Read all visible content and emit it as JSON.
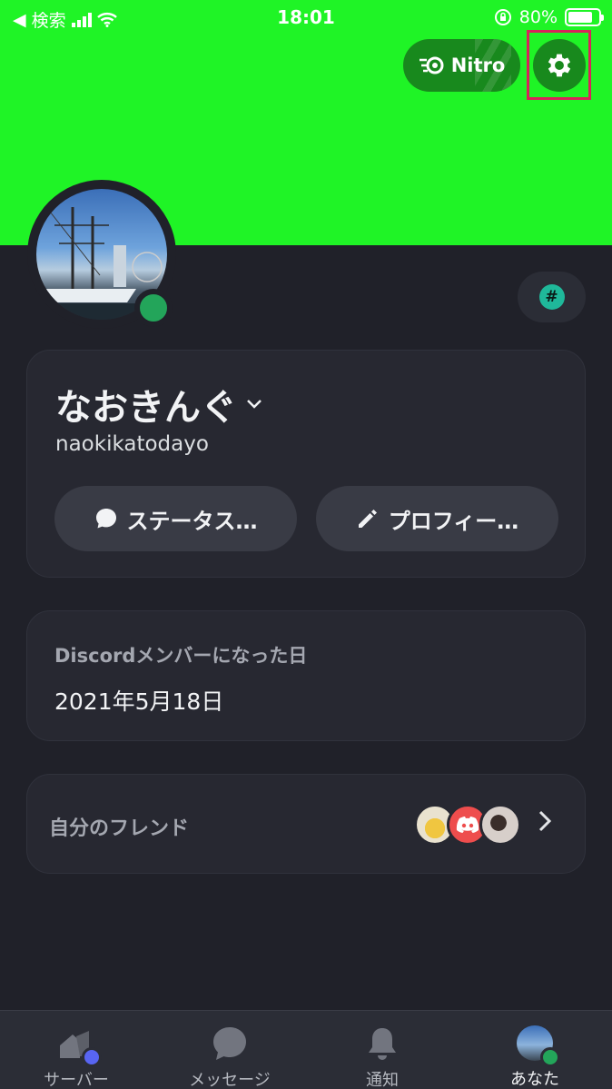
{
  "status_bar": {
    "back_label": "検索",
    "time": "18:01",
    "battery": "80%",
    "battery_level": 0.8
  },
  "header": {
    "nitro_label": "Nitro",
    "banner_color": "#1ff426"
  },
  "profile": {
    "display_name": "なおきんぐ",
    "username": "naokikatodayo",
    "status_button": "ステータス…",
    "profile_button": "プロフィー…",
    "online_color": "#23a55a"
  },
  "member_since": {
    "label": "Discordメンバーになった日",
    "date": "2021年5月18日"
  },
  "friends": {
    "label": "自分のフレンド"
  },
  "nav": {
    "items": [
      {
        "label": "サーバー",
        "icon": "servers-icon"
      },
      {
        "label": "メッセージ",
        "icon": "message-icon"
      },
      {
        "label": "通知",
        "icon": "bell-icon"
      },
      {
        "label": "あなた",
        "icon": "avatar-icon"
      }
    ]
  }
}
